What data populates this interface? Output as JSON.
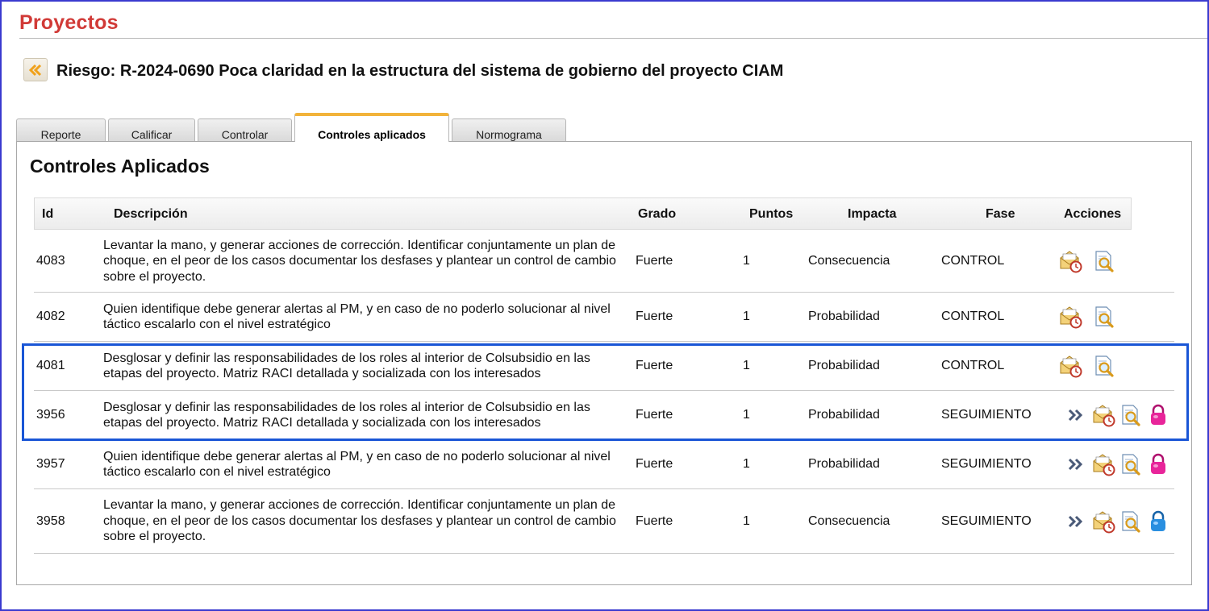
{
  "page_title": "Proyectos",
  "risk_title": "Riesgo: R-2024-0690 Poca claridad en la estructura del sistema de gobierno del proyecto CIAM",
  "tabs": [
    {
      "label": "Reporte"
    },
    {
      "label": "Calificar"
    },
    {
      "label": "Controlar"
    },
    {
      "label": "Controles aplicados"
    },
    {
      "label": "Normograma"
    }
  ],
  "active_tab": "Controles aplicados",
  "section_heading": "Controles Aplicados",
  "columns": [
    "Id",
    "Descripción",
    "Grado",
    "Puntos",
    "Impacta",
    "Fase",
    "Acciones"
  ],
  "rows": [
    {
      "id": "4083",
      "descripcion": "Levantar la mano, y generar acciones de corrección. Identificar conjuntamente un plan de choque, en el peor de los casos documentar los desfases y plantear un control de cambio sobre el proyecto.",
      "grado": "Fuerte",
      "puntos": "1",
      "impacta": "Consecuencia",
      "fase": "CONTROL",
      "actions": [
        "mail-clock-icon",
        "document-search-icon"
      ]
    },
    {
      "id": "4082",
      "descripcion": "Quien identifique debe generar alertas al PM, y en caso de no poderlo solucionar al nivel táctico escalarlo con el nivel estratégico",
      "grado": "Fuerte",
      "puntos": "1",
      "impacta": "Probabilidad",
      "fase": "CONTROL",
      "actions": [
        "mail-clock-icon",
        "document-search-icon"
      ]
    },
    {
      "id": "4081",
      "descripcion": "Desglosar y definir las responsabilidades de los roles al interior de Colsubsidio en las etapas del proyecto. Matriz RACI detallada y socializada con los interesados",
      "grado": "Fuerte",
      "puntos": "1",
      "impacta": "Probabilidad",
      "fase": "CONTROL",
      "actions": [
        "mail-clock-icon",
        "document-search-icon"
      ]
    },
    {
      "id": "3956",
      "descripcion": "Desglosar y definir las responsabilidades de los roles al interior de Colsubsidio en las etapas del proyecto. Matriz RACI detallada y socializada con los interesados",
      "grado": "Fuerte",
      "puntos": "1",
      "impacta": "Probabilidad",
      "fase": "SEGUIMIENTO",
      "actions": [
        "double-chevron-right-icon",
        "mail-clock-icon",
        "document-search-icon",
        "lock-pink-icon"
      ]
    },
    {
      "id": "3957",
      "descripcion": "Quien identifique debe generar alertas al PM, y en caso de no poderlo solucionar al nivel táctico escalarlo con el nivel estratégico",
      "grado": "Fuerte",
      "puntos": "1",
      "impacta": "Probabilidad",
      "fase": "SEGUIMIENTO",
      "actions": [
        "double-chevron-right-icon",
        "mail-clock-icon",
        "document-search-icon",
        "lock-pink-icon"
      ]
    },
    {
      "id": "3958",
      "descripcion": "Levantar la mano, y generar acciones de corrección. Identificar conjuntamente un plan de choque, en el peor de los casos documentar los desfases y plantear un control de cambio sobre el proyecto.",
      "grado": "Fuerte",
      "puntos": "1",
      "impacta": "Consecuencia",
      "fase": "SEGUIMIENTO",
      "actions": [
        "double-chevron-right-icon",
        "mail-clock-icon",
        "document-search-icon",
        "lock-blue-icon"
      ]
    }
  ],
  "colors": {
    "title_red": "#d13a37",
    "tab_accent": "#f2b33a",
    "highlight_blue": "#1a56d6",
    "lock_pink": "#e8259a",
    "lock_blue": "#2a8fe0"
  }
}
